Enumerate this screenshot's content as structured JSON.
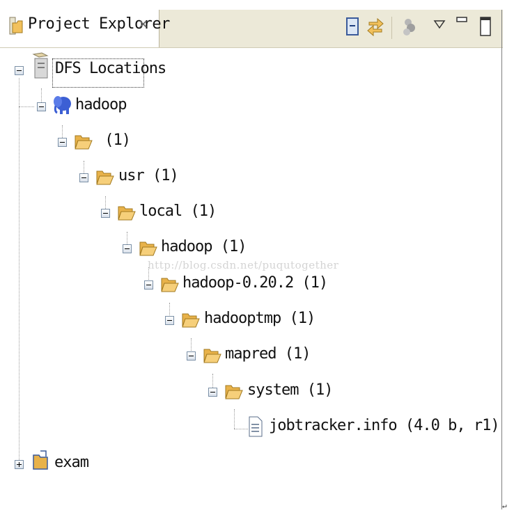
{
  "view": {
    "title": "Project Explorer",
    "icons": {
      "tab": "project-explorer-icon",
      "close": "close-icon",
      "collapse": "collapse-all-icon",
      "link": "link-with-editor-icon",
      "filter": "filter-icon",
      "menu": "view-menu-icon",
      "minimize": "minimize-icon",
      "maximize": "maximize-icon"
    }
  },
  "tree": {
    "dfs_locations": "DFS Locations",
    "hadoop_server": "hadoop",
    "root_folder": " (1)",
    "usr": "usr (1)",
    "local": "local (1)",
    "hadoop_dir": "hadoop (1)",
    "hadoop_version": "hadoop-0.20.2 (1)",
    "hadooptmp": "hadooptmp (1)",
    "mapred": "mapred (1)",
    "system": "system (1)",
    "jobtracker": "jobtracker.info (4.0 b, r1)",
    "exam": "exam"
  },
  "watermark": "http://blog.csdn.net/puqutogether",
  "corner_mark": "↵",
  "colors": {
    "tab_bg": "#ece9d8",
    "folder": "#f2c15c",
    "elephant": "#3c5fd4"
  }
}
